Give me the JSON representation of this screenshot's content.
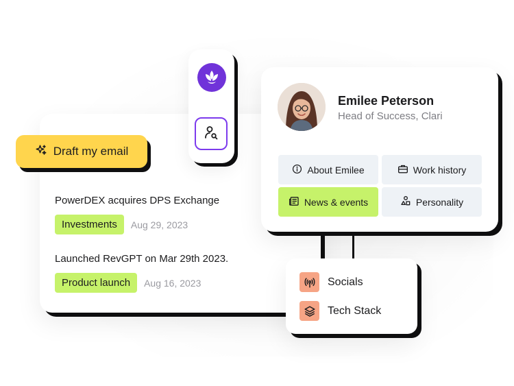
{
  "draft_button": {
    "label": "Draft my email",
    "icon": "sparkle-icon",
    "color": "#ffd54d"
  },
  "toolbar_pill": {
    "logo_icon": "clari-logo-icon",
    "logo_color": "#7033d9",
    "search_icon": "person-search-icon",
    "accent": "#7c3aed"
  },
  "feed": {
    "items": [
      {
        "title": "PowerDEX acquires DPS Exchange",
        "tag": "Investments",
        "date": "Aug 29, 2023"
      },
      {
        "title": "Launched RevGPT on Mar 29th 2023.",
        "tag": "Product launch",
        "date": "Aug 16, 2023"
      }
    ],
    "tag_color": "#c6f26a"
  },
  "profile": {
    "name": "Emilee Peterson",
    "role": "Head of Success, Clari",
    "tabs": [
      {
        "label": "About Emilee",
        "icon": "info-icon",
        "active": false
      },
      {
        "label": "Work history",
        "icon": "briefcase-icon",
        "active": false
      },
      {
        "label": "News & events",
        "icon": "newspaper-icon",
        "active": true
      },
      {
        "label": "Personality",
        "icon": "shapes-icon",
        "active": false
      }
    ],
    "active_tab_color": "#c6f26a",
    "tab_color": "#eef2f6"
  },
  "links": {
    "items": [
      {
        "label": "Socials",
        "icon": "broadcast-icon"
      },
      {
        "label": "Tech Stack",
        "icon": "layers-icon"
      }
    ],
    "icon_color": "#f6a485"
  }
}
